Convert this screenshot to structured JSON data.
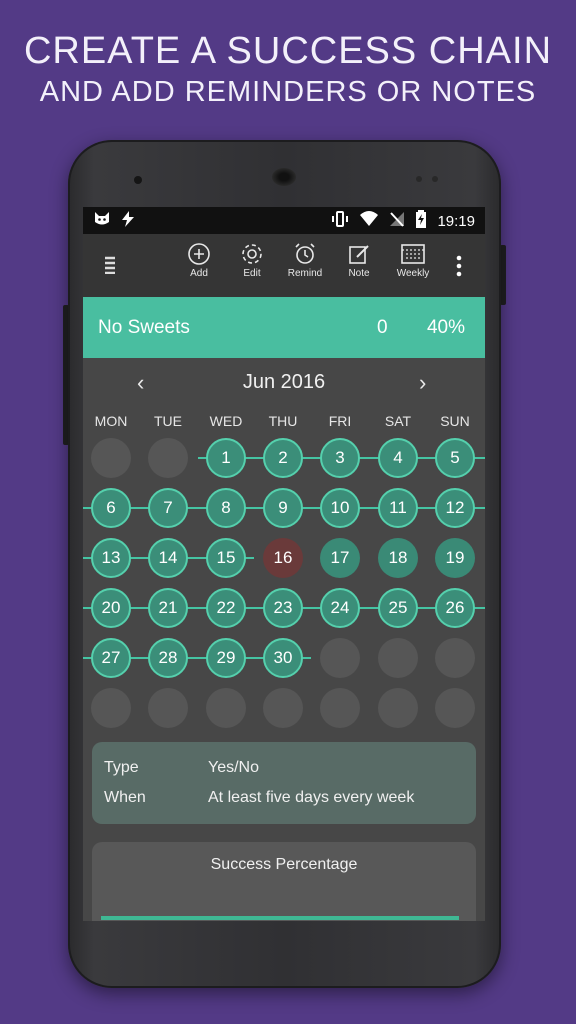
{
  "promo": {
    "line1": "CREATE A SUCCESS CHAIN",
    "line2": "AND ADD REMINDERS OR NOTES"
  },
  "statusbar": {
    "time": "19:19"
  },
  "toolbar": {
    "add": "Add",
    "edit": "Edit",
    "remind": "Remind",
    "note": "Note",
    "weekly": "Weekly"
  },
  "habit": {
    "name": "No Sweets",
    "count": "0",
    "percent": "40%"
  },
  "calendar": {
    "month": "Jun 2016",
    "weekdays": [
      "MON",
      "TUE",
      "WED",
      "THU",
      "FRI",
      "SAT",
      "SUN"
    ],
    "days": [
      {
        "n": "1",
        "state": "done"
      },
      {
        "n": "2",
        "state": "done"
      },
      {
        "n": "3",
        "state": "done"
      },
      {
        "n": "4",
        "state": "done"
      },
      {
        "n": "5",
        "state": "done"
      },
      {
        "n": "6",
        "state": "done"
      },
      {
        "n": "7",
        "state": "done"
      },
      {
        "n": "8",
        "state": "done"
      },
      {
        "n": "9",
        "state": "done"
      },
      {
        "n": "10",
        "state": "done"
      },
      {
        "n": "11",
        "state": "done"
      },
      {
        "n": "12",
        "state": "done"
      },
      {
        "n": "13",
        "state": "done"
      },
      {
        "n": "14",
        "state": "done"
      },
      {
        "n": "15",
        "state": "done"
      },
      {
        "n": "16",
        "state": "today"
      },
      {
        "n": "17",
        "state": "plain"
      },
      {
        "n": "18",
        "state": "plain"
      },
      {
        "n": "19",
        "state": "plain"
      },
      {
        "n": "20",
        "state": "done"
      },
      {
        "n": "21",
        "state": "done"
      },
      {
        "n": "22",
        "state": "done"
      },
      {
        "n": "23",
        "state": "done"
      },
      {
        "n": "24",
        "state": "done"
      },
      {
        "n": "25",
        "state": "done"
      },
      {
        "n": "26",
        "state": "done"
      },
      {
        "n": "27",
        "state": "done"
      },
      {
        "n": "28",
        "state": "done"
      },
      {
        "n": "29",
        "state": "done"
      },
      {
        "n": "30",
        "state": "done"
      }
    ]
  },
  "info": {
    "type_label": "Type",
    "type_value": "Yes/No",
    "when_label": "When",
    "when_value": "At least five days every week"
  },
  "success": {
    "title": "Success Percentage"
  },
  "colors": {
    "background": "#533a86",
    "accent": "#49bea0",
    "today": "#6a3a3a"
  }
}
